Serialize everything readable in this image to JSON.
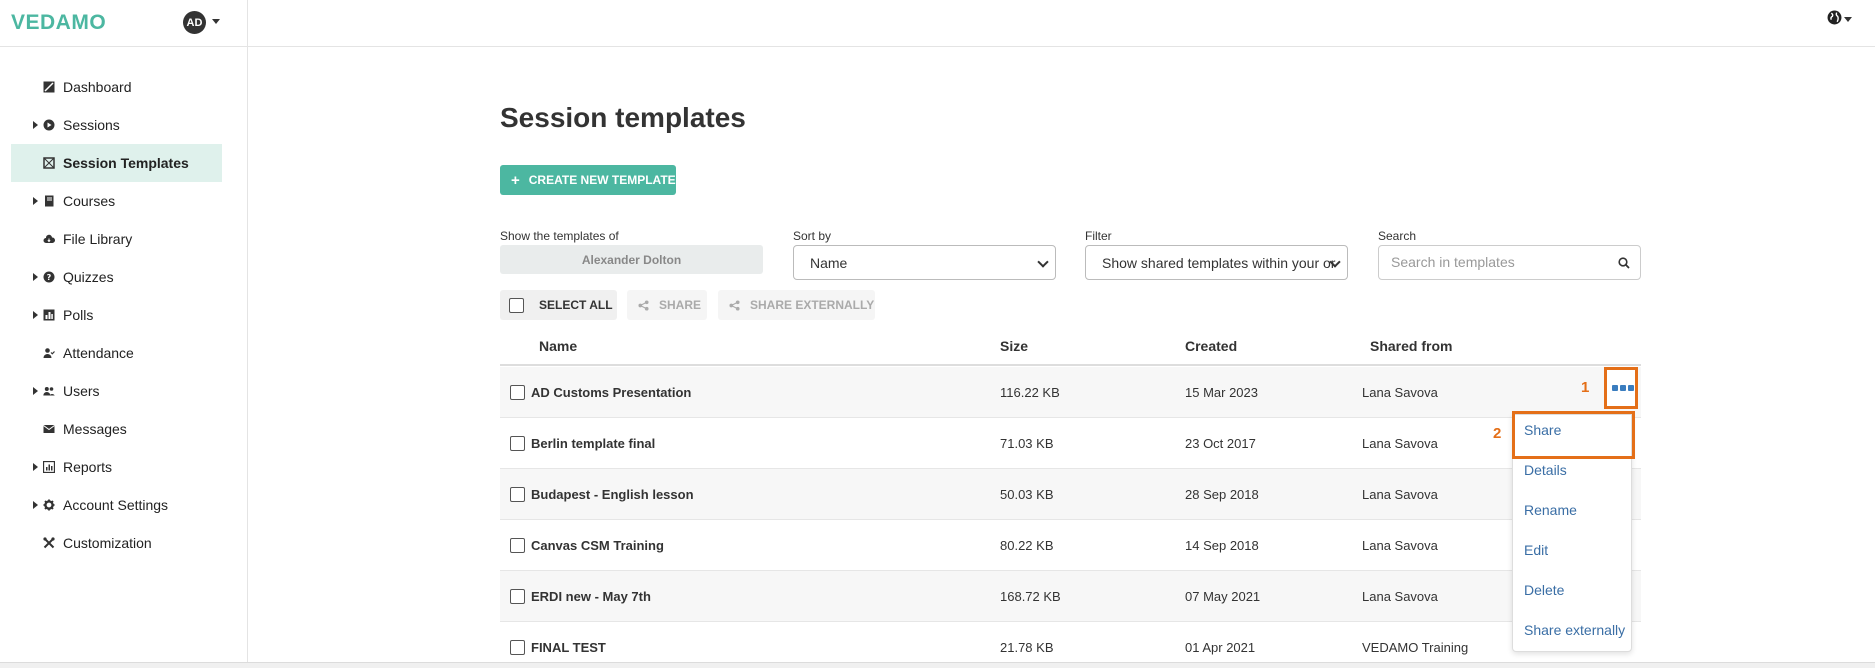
{
  "brand": {
    "logo": "VEDAMO",
    "avatar_initials": "AD"
  },
  "sidebar": {
    "items": [
      {
        "label": "Dashboard",
        "icon": "dashboard-icon",
        "expandable": false,
        "active": false
      },
      {
        "label": "Sessions",
        "icon": "play-circle-icon",
        "expandable": true,
        "active": false
      },
      {
        "label": "Session Templates",
        "icon": "template-icon",
        "expandable": false,
        "active": true
      },
      {
        "label": "Courses",
        "icon": "book-icon",
        "expandable": true,
        "active": false
      },
      {
        "label": "File Library",
        "icon": "cloud-icon",
        "expandable": false,
        "active": false
      },
      {
        "label": "Quizzes",
        "icon": "question-circle-icon",
        "expandable": true,
        "active": false
      },
      {
        "label": "Polls",
        "icon": "chart-icon",
        "expandable": true,
        "active": false
      },
      {
        "label": "Attendance",
        "icon": "user-check-icon",
        "expandable": false,
        "active": false
      },
      {
        "label": "Users",
        "icon": "users-icon",
        "expandable": true,
        "active": false
      },
      {
        "label": "Messages",
        "icon": "envelope-icon",
        "expandable": false,
        "active": false
      },
      {
        "label": "Reports",
        "icon": "report-icon",
        "expandable": true,
        "active": false
      },
      {
        "label": "Account Settings",
        "icon": "gear-icon",
        "expandable": true,
        "active": false
      },
      {
        "label": "Customization",
        "icon": "tools-icon",
        "expandable": false,
        "active": false
      }
    ]
  },
  "main": {
    "title": "Session templates",
    "create_button": "CREATE NEW TEMPLATE",
    "show_label": "Show the templates of",
    "owner": "Alexander Dolton",
    "sort_label": "Sort by",
    "sort_value": "Name",
    "filter_label": "Filter",
    "filter_value": "Show shared templates within your or",
    "search_label": "Search",
    "search_placeholder": "Search in templates",
    "toolbar": {
      "select_all": "SELECT ALL",
      "share": "SHARE",
      "share_externally": "SHARE EXTERNALLY"
    },
    "columns": {
      "name": "Name",
      "size": "Size",
      "created": "Created",
      "shared_from": "Shared from"
    },
    "rows": [
      {
        "name": "AD Customs Presentation",
        "size": "116.22 KB",
        "created": "15 Mar 2023",
        "shared_from": "Lana Savova"
      },
      {
        "name": "Berlin template final",
        "size": "71.03 KB",
        "created": "23 Oct 2017",
        "shared_from": "Lana Savova"
      },
      {
        "name": "Budapest - English lesson",
        "size": "50.03 KB",
        "created": "28 Sep 2018",
        "shared_from": "Lana Savova"
      },
      {
        "name": "Canvas CSM Training",
        "size": "80.22 KB",
        "created": "14 Sep 2018",
        "shared_from": "Lana Savova"
      },
      {
        "name": "ERDI new - May 7th",
        "size": "168.72 KB",
        "created": "07 May 2021",
        "shared_from": "Lana Savova"
      },
      {
        "name": "FINAL TEST",
        "size": "21.78 KB",
        "created": "01 Apr 2021",
        "shared_from": "VEDAMO Training"
      }
    ],
    "context_menu": [
      "Share",
      "Details",
      "Rename",
      "Edit",
      "Delete",
      "Share externally"
    ],
    "callouts": {
      "first": "1",
      "second": "2"
    }
  },
  "colors": {
    "brand": "#4cb7a1",
    "highlight": "#e46f18",
    "link": "#3a6ea5",
    "active_bg": "#dff1ec"
  }
}
